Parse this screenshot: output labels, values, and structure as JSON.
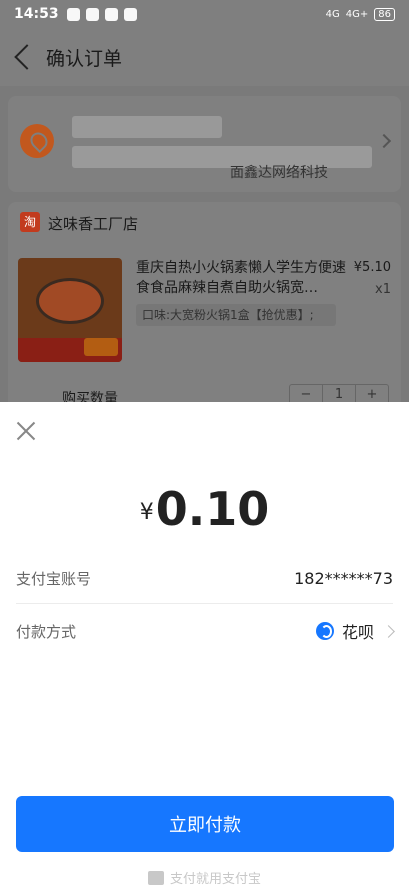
{
  "status_bar": {
    "time": "14:53",
    "battery": "86",
    "network_1": "4G",
    "network_2": "4G+"
  },
  "header": {
    "title": "确认订单"
  },
  "address": {
    "text_visible": "面鑫达网络科技"
  },
  "shop": {
    "logo_char": "淘",
    "name": "这味香工厂店",
    "product": {
      "title": "重庆自热小火锅素懒人学生方便速食食品麻辣自煮自助火锅宽…",
      "price": "¥5.10",
      "quantity": "x1",
      "spec": "口味:大宽粉火锅1盒【抢优惠】;"
    },
    "quantity_label": "购买数量",
    "stepper": {
      "minus": "−",
      "value": "1",
      "plus": "+"
    }
  },
  "payment_sheet": {
    "currency_symbol": "¥",
    "amount": "0.10",
    "account_label": "支付宝账号",
    "account_value": "182******73",
    "method_label": "付款方式",
    "method_value": "花呗",
    "pay_button": "立即付款",
    "footer": "支付就用支付宝"
  },
  "colors": {
    "accent": "#1677ff",
    "overlay": "#7f7f7f"
  }
}
